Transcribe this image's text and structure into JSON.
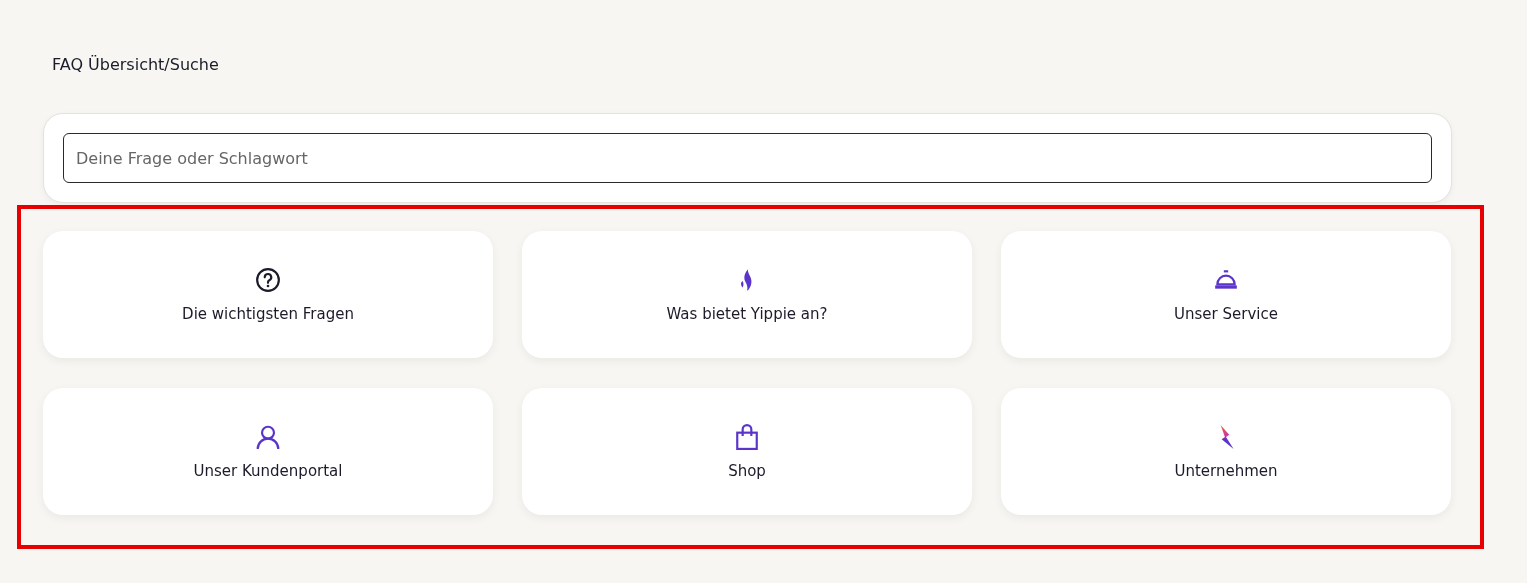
{
  "heading": "FAQ Übersicht/Suche",
  "search": {
    "placeholder": "Deine Frage oder Schlagwort"
  },
  "highlighted": true,
  "categories": [
    {
      "label": "Die wichtigsten Fragen"
    },
    {
      "label": "Was bietet Yippie an?"
    },
    {
      "label": "Unser Service"
    },
    {
      "label": "Unser Kundenportal"
    },
    {
      "label": "Shop"
    },
    {
      "label": "Unternehmen"
    }
  ]
}
